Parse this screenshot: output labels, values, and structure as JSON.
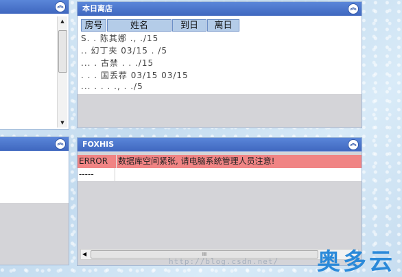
{
  "panels": {
    "top_left": {
      "title": ""
    },
    "bottom_left": {
      "title": ""
    },
    "top_right": {
      "title": "本日离店",
      "columns": [
        "房号",
        "姓名",
        "到日",
        "离日"
      ],
      "blurred_rows": [
        "S. .  陈其娜    .,    ./15",
        "..    幻丁夹    03/15  . /5",
        "...   . 古禁     .      . ./15",
        ". . .   国丢荐  03/15   03/15",
        "...   . .   .      ., .   ./5",
        "...   .      .  .   .     ."
      ]
    },
    "bottom_right": {
      "title": "FOXHIS",
      "rows": [
        {
          "col1": "ERROR",
          "col2": "数据库空间紧张, 请电脑系统管理人员注意!"
        },
        {
          "col1": "-----",
          "col2": ""
        }
      ],
      "scroll_grip": "III"
    }
  },
  "icons": {
    "collapse": "double-chevron-up-icon",
    "scroll_up": "arrow-up-icon",
    "scroll_down": "arrow-down-icon",
    "scroll_left": "arrow-left-icon"
  },
  "watermark": "http://blog.csdn.net/",
  "logo_text": "奥多云",
  "colors": {
    "title_bar": "#4a75cc",
    "error_row": "#f08484",
    "header_cell": "#b4cce8",
    "logo": "#2a89d9"
  }
}
